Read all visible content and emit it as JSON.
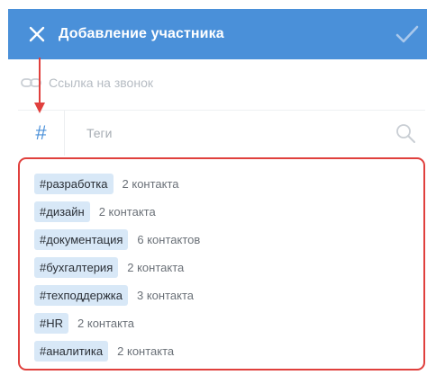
{
  "header": {
    "title": "Добавление участника"
  },
  "call_link": {
    "label": "Ссылка на звонок"
  },
  "tag_search": {
    "hash_symbol": "#",
    "placeholder": "Теги"
  },
  "tags": [
    {
      "name": "#разработка",
      "count": "2 контакта"
    },
    {
      "name": "#дизайн",
      "count": "2 контакта"
    },
    {
      "name": "#документация",
      "count": "6 контактов"
    },
    {
      "name": "#бухгалтерия",
      "count": "2 контакта"
    },
    {
      "name": "#техподдержка",
      "count": "3 контакта"
    },
    {
      "name": "#HR",
      "count": "2 контакта"
    },
    {
      "name": "#аналитика",
      "count": "2 контакта"
    }
  ],
  "colors": {
    "header_bg": "#4a90d9",
    "accent": "#4a90d9",
    "chip_bg": "#d8e8f7",
    "annotation": "#e0403d"
  },
  "icons": [
    "close-icon",
    "checkmark-icon",
    "link-icon",
    "hash-icon",
    "search-icon",
    "annotation-arrow"
  ]
}
